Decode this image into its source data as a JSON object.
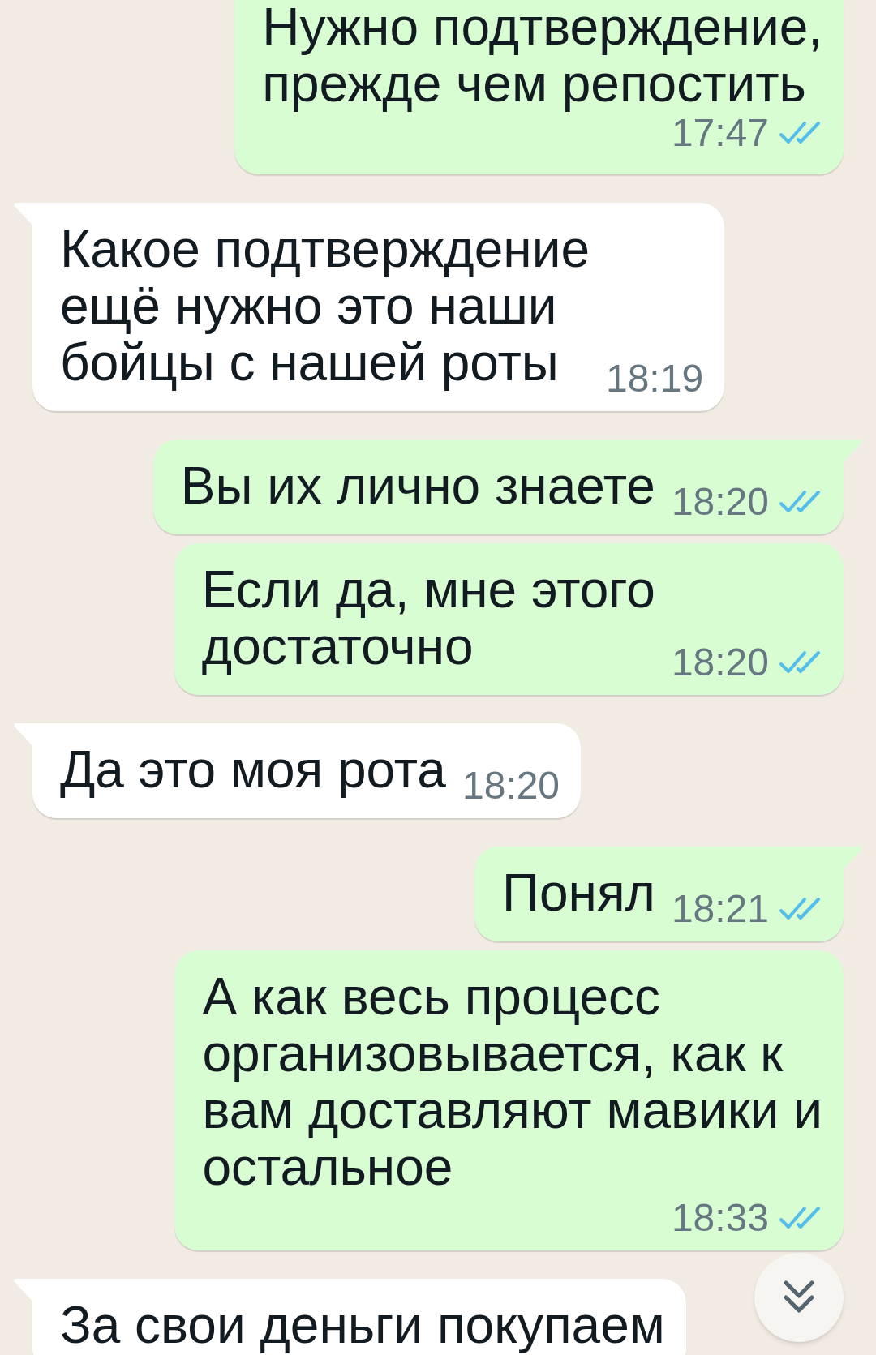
{
  "messages": [
    {
      "kind": "outgoing",
      "lines": [
        "Нужно подтверждение,",
        "прежде чем репостить"
      ],
      "time": "17:47",
      "read": true,
      "tail": false
    },
    {
      "kind": "incoming",
      "lines": [
        "Какое подтверждение",
        "ещё нужно это наши",
        "бойцы с нашей роты"
      ],
      "time": "18:19",
      "tail": true
    },
    {
      "kind": "outgoing",
      "lines": [
        "Вы их лично знаете"
      ],
      "time": "18:20",
      "read": true,
      "tail": true
    },
    {
      "kind": "outgoing",
      "lines": [
        "Если да, мне этого",
        "достаточно"
      ],
      "time": "18:20",
      "read": true,
      "tail": false
    },
    {
      "kind": "incoming",
      "lines": [
        "Да это моя рота"
      ],
      "time": "18:20",
      "tail": true
    },
    {
      "kind": "outgoing",
      "lines": [
        "Понял"
      ],
      "time": "18:21",
      "read": true,
      "tail": true
    },
    {
      "kind": "outgoing",
      "lines": [
        "А как весь процесс",
        "организовывается, как к",
        "вам доставляют мавики и",
        "остальное"
      ],
      "time": "18:33",
      "read": true,
      "tail": false
    },
    {
      "kind": "incoming",
      "lines": [
        "За свои деньги покупаем"
      ],
      "tail": true
    }
  ]
}
